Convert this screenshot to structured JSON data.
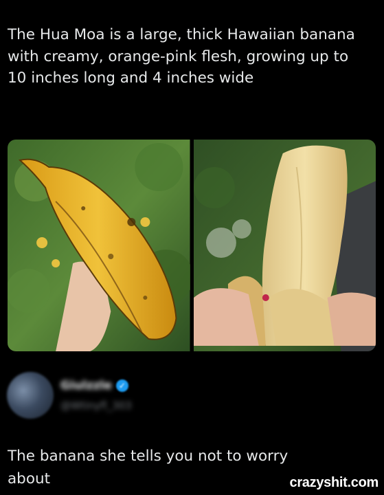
{
  "post": {
    "text": "The Hua Moa is a large, thick Hawaiian banana with creamy, orange-pink flesh, growing up to 10 inches long and 4 inches wide"
  },
  "media": {
    "images": [
      {
        "name": "whole-banana-photo",
        "subject": "hand holding large yellow Hua Moa banana among leaves"
      },
      {
        "name": "peeled-banana-photo",
        "subject": "hand holding peeled Hua Moa banana showing pale flesh"
      }
    ]
  },
  "reply": {
    "display_name": "Giulzzle",
    "handle": "@Wtinyfl_303",
    "verified_icon": "verified-check-icon",
    "text": "The banana she tells you not to worry about"
  },
  "watermark": "crazyshit.com"
}
